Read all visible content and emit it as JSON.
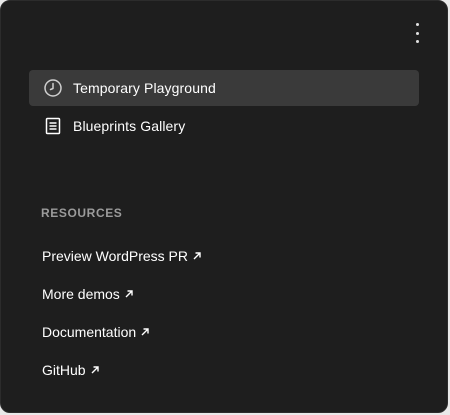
{
  "menu": {
    "kebab_icon": "more-vertical-icon"
  },
  "nav": {
    "items": [
      {
        "label": "Temporary Playground",
        "icon": "clock-icon",
        "active": true
      },
      {
        "label": "Blueprints Gallery",
        "icon": "document-icon",
        "active": false
      }
    ]
  },
  "resources": {
    "heading": "RESOURCES",
    "links": [
      {
        "label": "Preview WordPress PR",
        "icon": "external-arrow-icon"
      },
      {
        "label": "More demos",
        "icon": "external-arrow-icon"
      },
      {
        "label": "Documentation",
        "icon": "external-arrow-icon"
      },
      {
        "label": "GitHub",
        "icon": "external-arrow-icon"
      }
    ]
  },
  "colors": {
    "panel_bg": "#1e1e1e",
    "active_item_bg": "#3a3a3a",
    "heading": "#9b9b9b",
    "text": "#ffffff"
  }
}
